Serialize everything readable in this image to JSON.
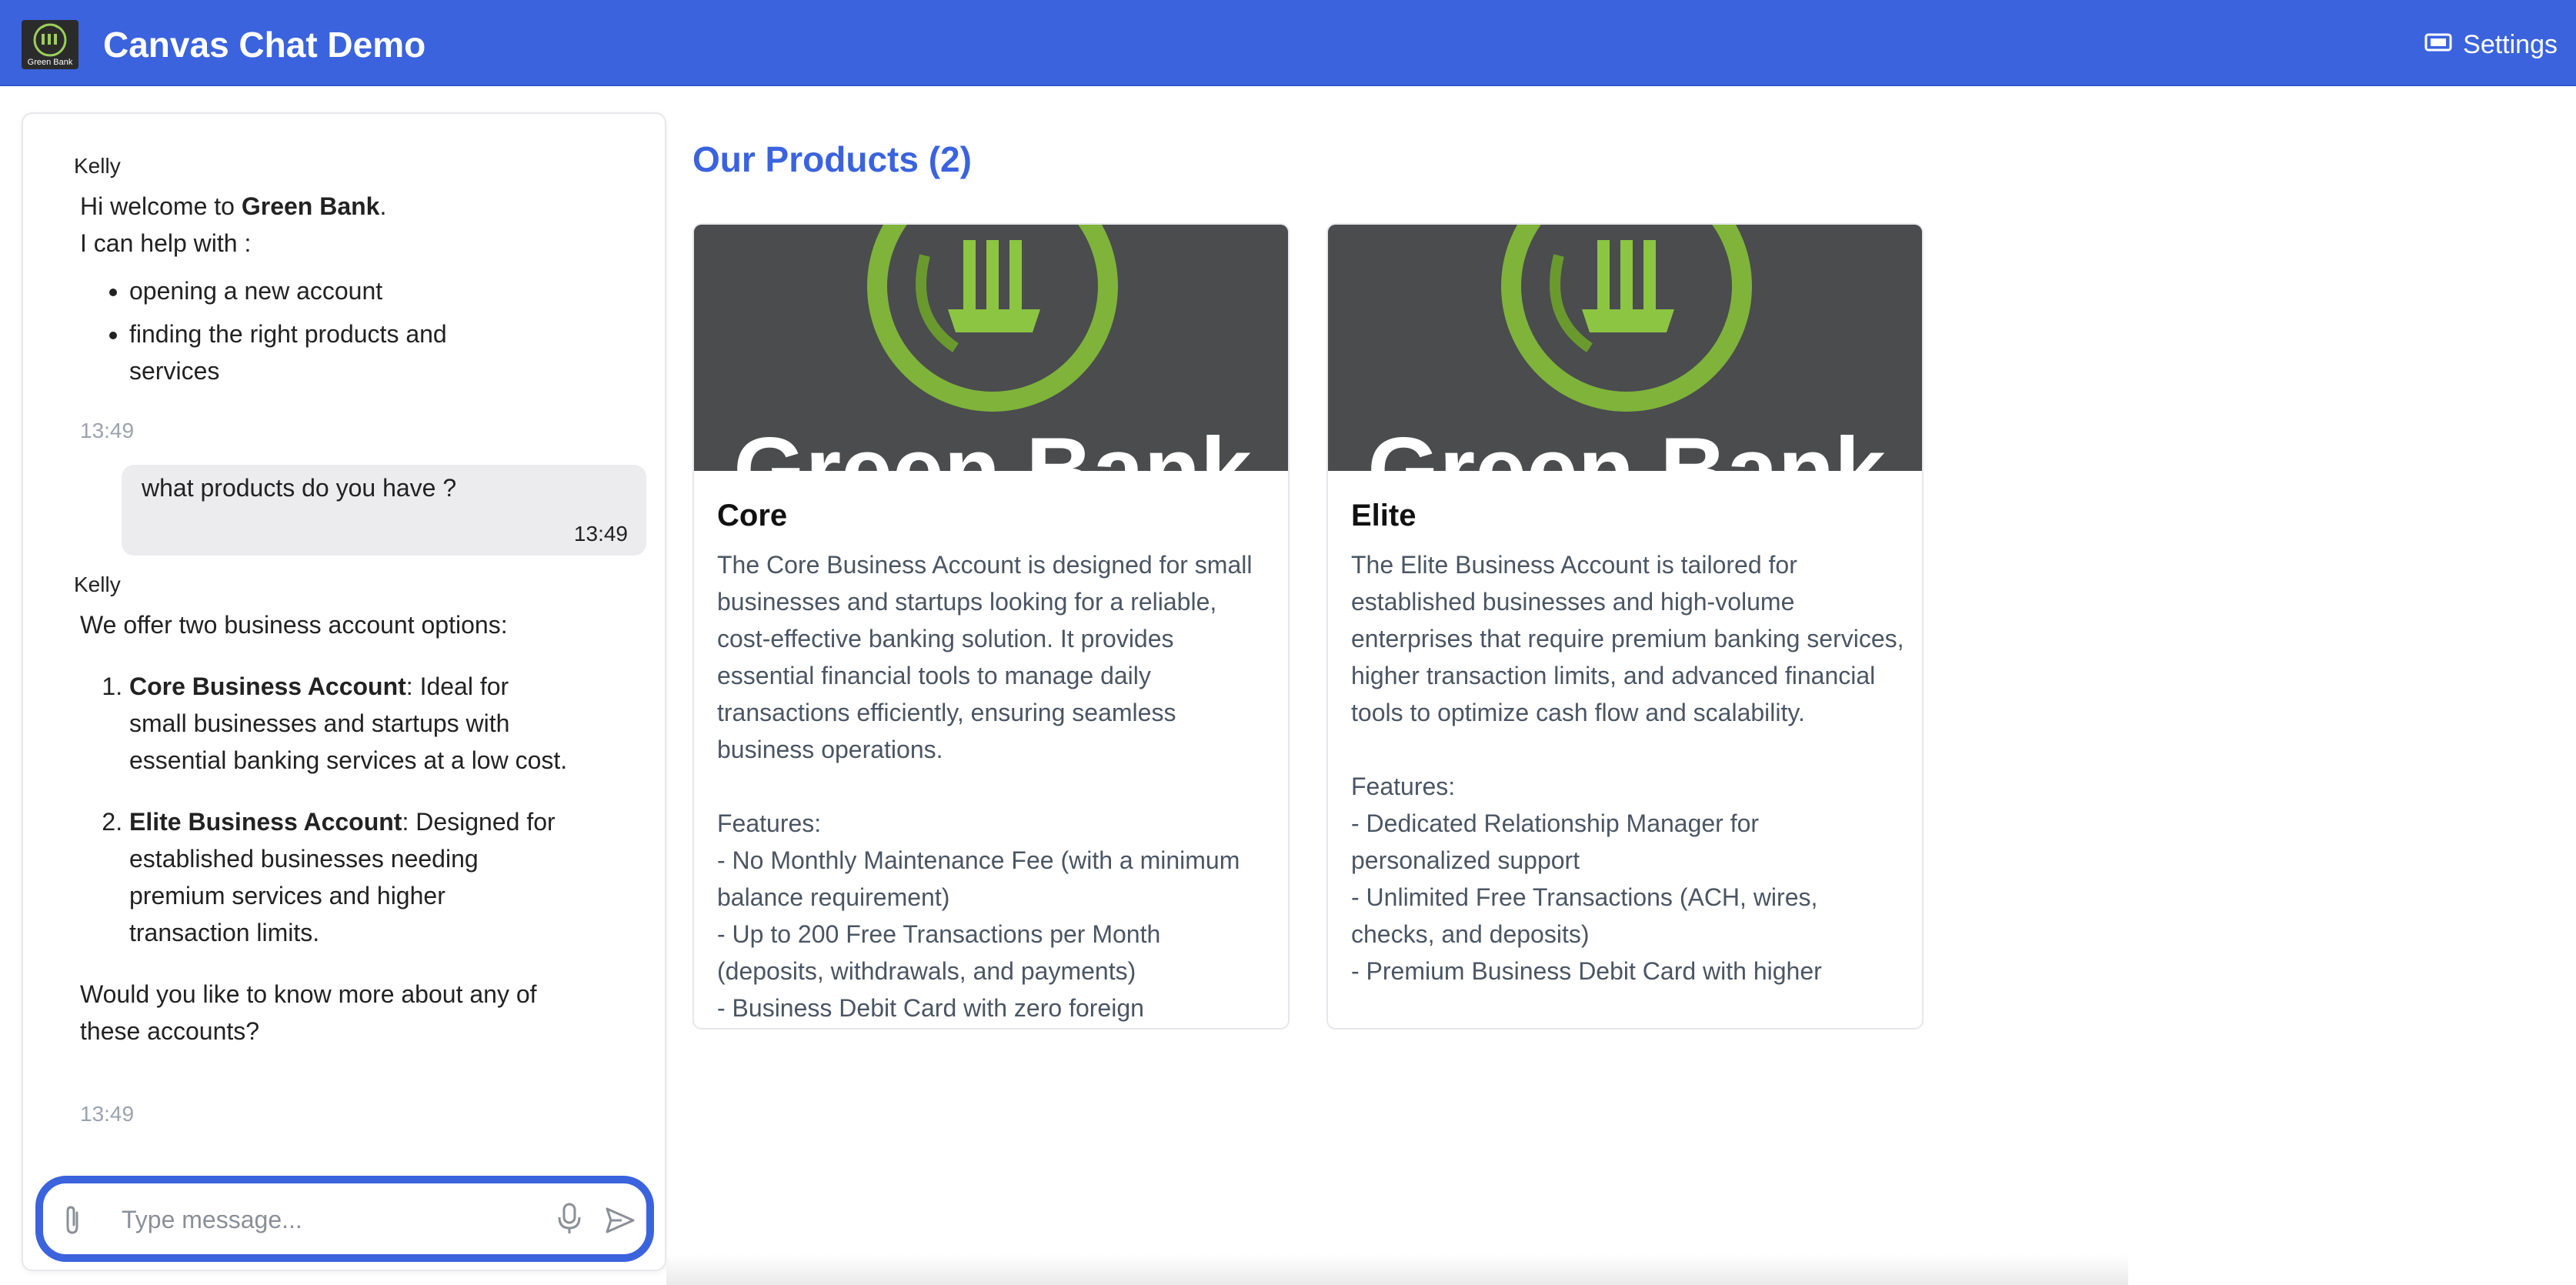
{
  "header": {
    "app_title": "Canvas Chat Demo",
    "settings_label": "Settings",
    "logo_caption": "Green Bank",
    "brand_color": "#3b63de"
  },
  "chat": {
    "messages": [
      {
        "author": "Kelly",
        "greeting_prefix": "Hi welcome to ",
        "greeting_bank": "Green Bank",
        "greeting_suffix": ".",
        "help_intro": "I can help with :",
        "items": [
          "opening a new account",
          "finding the right products and services"
        ],
        "time": "13:49"
      },
      {
        "author": "user",
        "text": "what products do you have ?",
        "time": "13:49"
      },
      {
        "author": "Kelly",
        "intro": "We offer two business account options:",
        "options": [
          {
            "name": "Core Business Account",
            "desc": ": Ideal for small businesses and startups with essential banking services at a low cost."
          },
          {
            "name": "Elite Business Account",
            "desc": ": Designed for established businesses needing premium services and higher transaction limits."
          }
        ],
        "closing": "Would you like to know more about any of these accounts?",
        "time": "13:49"
      }
    ],
    "composer_placeholder": "Type message..."
  },
  "products": {
    "title": "Our Products (2)",
    "cards": [
      {
        "name": "Core",
        "image_text": "Green Bank",
        "body": "The Core Business Account is designed for small businesses and startups looking for a reliable, cost-effective banking solution. It provides essential financial tools to manage daily transactions efficiently, ensuring seamless business operations.\n\nFeatures:\n- No Monthly Maintenance Fee (with a minimum balance requirement)\n- Up to 200 Free Transactions per Month (deposits, withdrawals, and payments)\n- Business Debit Card with zero foreign"
      },
      {
        "name": "Elite",
        "image_text": "Green Bank",
        "body": "The Elite Business Account is tailored for established businesses and high-volume enterprises that require premium banking services, higher transaction limits, and advanced financial tools to optimize cash flow and scalability.\n\nFeatures:\n- Dedicated Relationship Manager for personalized support\n- Unlimited Free Transactions (ACH, wires, checks, and deposits)\n- Premium Business Debit Card with higher"
      }
    ]
  }
}
